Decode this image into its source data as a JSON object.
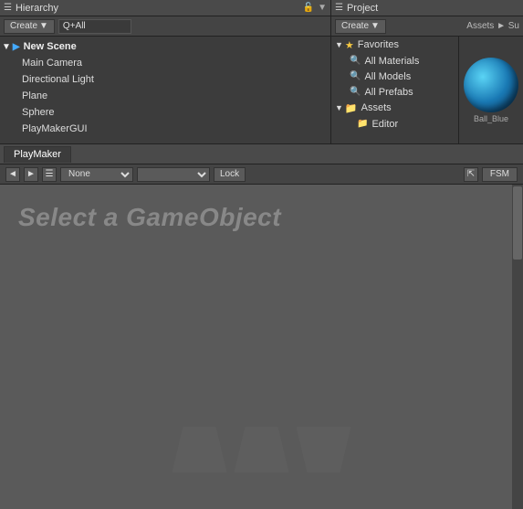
{
  "hierarchy": {
    "title": "Hierarchy",
    "create_label": "Create",
    "search_placeholder": "Q+All",
    "scene": {
      "name": "New Scene",
      "items": [
        {
          "name": "Main Camera"
        },
        {
          "name": "Directional Light"
        },
        {
          "name": "Plane"
        },
        {
          "name": "Sphere"
        },
        {
          "name": "PlayMakerGUI"
        }
      ]
    }
  },
  "project": {
    "title": "Project",
    "create_label": "Create",
    "breadcrumb": "Assets ► Su",
    "favorites": {
      "label": "Favorites",
      "items": [
        {
          "name": "All Materials"
        },
        {
          "name": "All Models"
        },
        {
          "name": "All Prefabs"
        }
      ]
    },
    "assets": {
      "label": "Assets",
      "sub_items": [
        {
          "name": "Editor"
        }
      ]
    },
    "preview": {
      "asset_name": "Ball_Blue"
    }
  },
  "playmaker": {
    "tab_label": "PlayMaker",
    "nav": {
      "back_label": "◄",
      "forward_label": "►",
      "menu_label": "☰",
      "dropdown_value": "None",
      "lock_label": "Lock"
    },
    "fsm_label": "FSM",
    "select_text": "Select a GameObject"
  }
}
